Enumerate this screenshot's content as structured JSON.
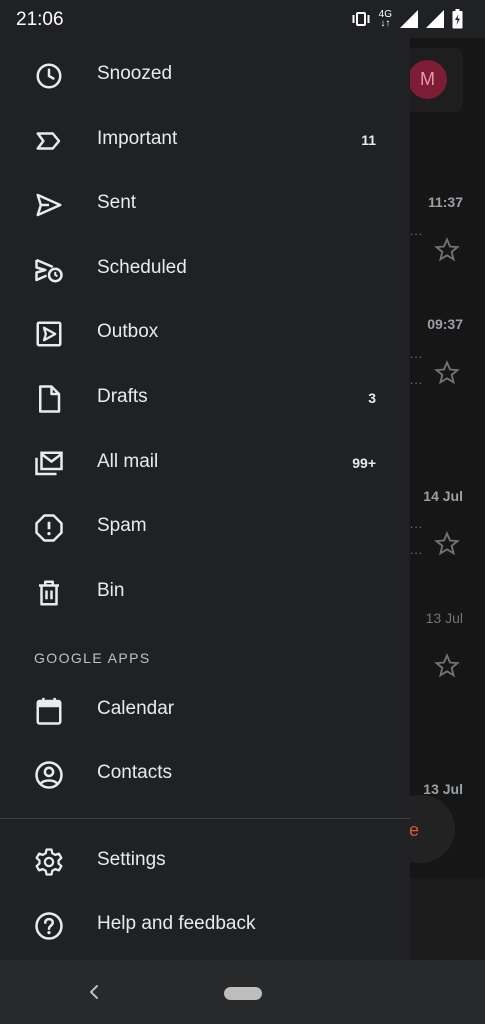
{
  "status_bar": {
    "time": "21:06",
    "network": "4G"
  },
  "inbox": {
    "avatar_initial": "M",
    "times": [
      "11:37",
      "09:37",
      "14 Jul",
      "13 Jul",
      "13 Jul"
    ],
    "compose_letter": "e"
  },
  "drawer": {
    "items": [
      {
        "label": "Snoozed",
        "icon": "clock-icon",
        "count": ""
      },
      {
        "label": "Important",
        "icon": "important-icon",
        "count": "11"
      },
      {
        "label": "Sent",
        "icon": "send-icon",
        "count": ""
      },
      {
        "label": "Scheduled",
        "icon": "scheduled-send-icon",
        "count": ""
      },
      {
        "label": "Outbox",
        "icon": "outbox-icon",
        "count": ""
      },
      {
        "label": "Drafts",
        "icon": "draft-icon",
        "count": "3"
      },
      {
        "label": "All mail",
        "icon": "all-mail-icon",
        "count": "99+"
      },
      {
        "label": "Spam",
        "icon": "spam-icon",
        "count": ""
      },
      {
        "label": "Bin",
        "icon": "bin-icon",
        "count": ""
      }
    ],
    "section_google_apps": "GOOGLE APPS",
    "apps": [
      {
        "label": "Calendar",
        "icon": "calendar-icon"
      },
      {
        "label": "Contacts",
        "icon": "contacts-icon"
      }
    ],
    "footer": [
      {
        "label": "Settings",
        "icon": "gear-icon"
      },
      {
        "label": "Help and feedback",
        "icon": "help-icon"
      }
    ]
  },
  "colors": {
    "drawer_bg": "#202124",
    "text": "#e8eaed",
    "avatar_bg": "#7c1c35",
    "accent_compose": "#d9593a"
  }
}
